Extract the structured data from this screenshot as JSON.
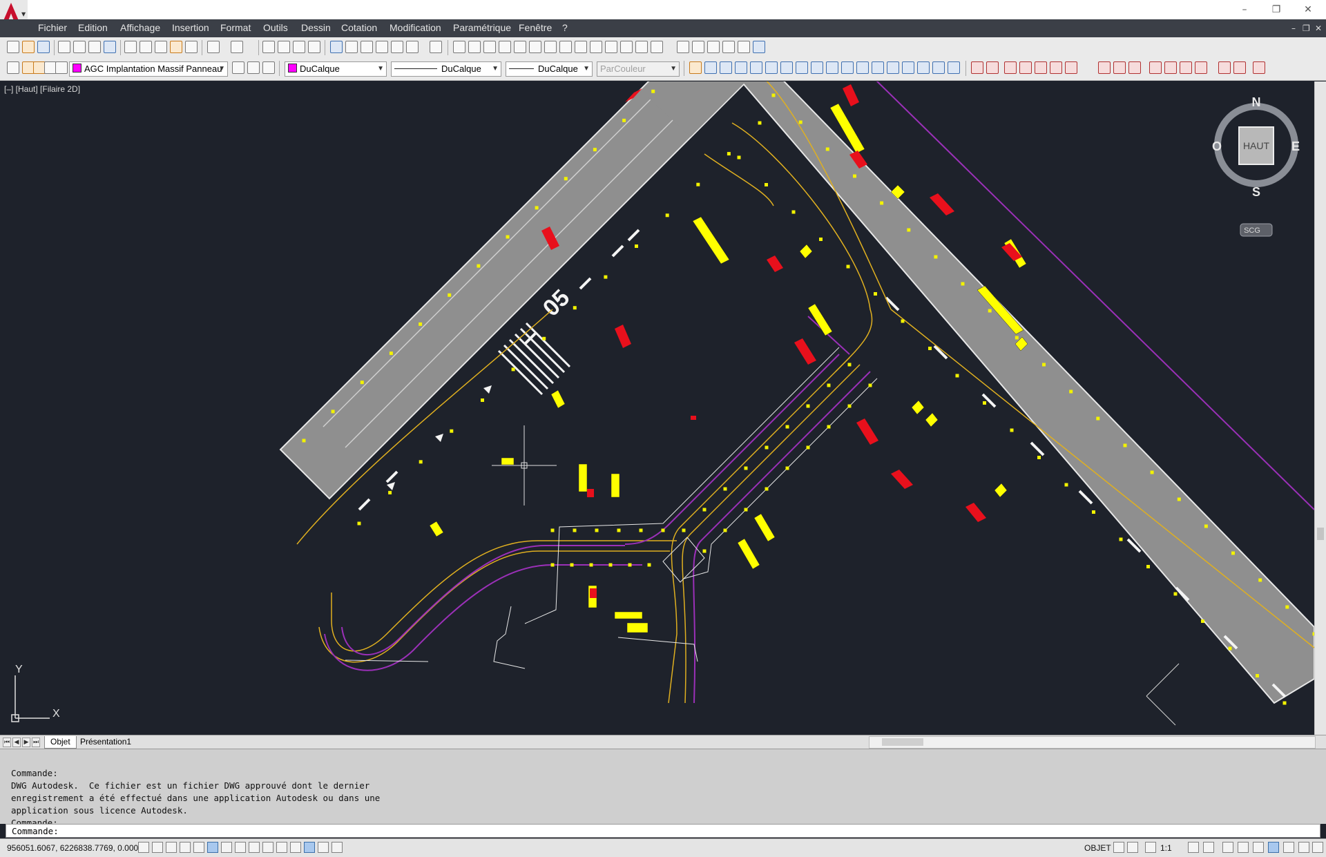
{
  "window": {
    "minimize_label": "–",
    "restore_label": "❐",
    "close_label": "✕"
  },
  "menu": {
    "items": [
      "Fichier",
      "Edition",
      "Affichage",
      "Insertion",
      "Format",
      "Outils",
      "Dessin",
      "Cotation",
      "Modification",
      "Paramétrique",
      "Fenêtre",
      "?"
    ],
    "mdi_minimize": "–",
    "mdi_restore": "❐",
    "mdi_close": "✕"
  },
  "layers": {
    "current_layer": "AGC Implantation Massif Panneau",
    "current_layer_color": "#ff00ff"
  },
  "properties": {
    "color": "DuCalque",
    "color_swatch": "#ff00ff",
    "linetype": "DuCalque",
    "lineweight": "DuCalque",
    "plotstyle": "ParCouleur"
  },
  "viewport": {
    "label": "[–] [Haut] [Filaire 2D]",
    "background": "#1e222b"
  },
  "viewcube": {
    "face": "HAUT",
    "north": "N",
    "south": "S",
    "east": "E",
    "west": "O",
    "ucs": "SCG"
  },
  "ucs_icon": {
    "x_label": "X",
    "y_label": "Y"
  },
  "drawing": {
    "runway_marking": "05",
    "colors": {
      "runway": "#8f8f8f",
      "taxi_edge": "#9b30b8",
      "centerline": "#e0b020",
      "sign": "#ffff00",
      "sign_red": "#e8101c",
      "light": "#f2f200",
      "outline": "#e8e8e8"
    }
  },
  "layout_tabs": {
    "items": [
      "Objet",
      "Présentation1"
    ],
    "active": "Objet"
  },
  "command": {
    "history": [
      "Commande:",
      "DWG Autodesk.  Ce fichier est un fichier DWG approuvé dont le dernier",
      "enregistrement a été effectué dans une application Autodesk ou dans une",
      "application sous licence Autodesk.",
      "Commande:"
    ],
    "prompt": "Commande:"
  },
  "status": {
    "coordinates": "956051.6067, 6226838.7769, 0.0000",
    "model_label": "OBJET",
    "scale_label": "1:1"
  }
}
